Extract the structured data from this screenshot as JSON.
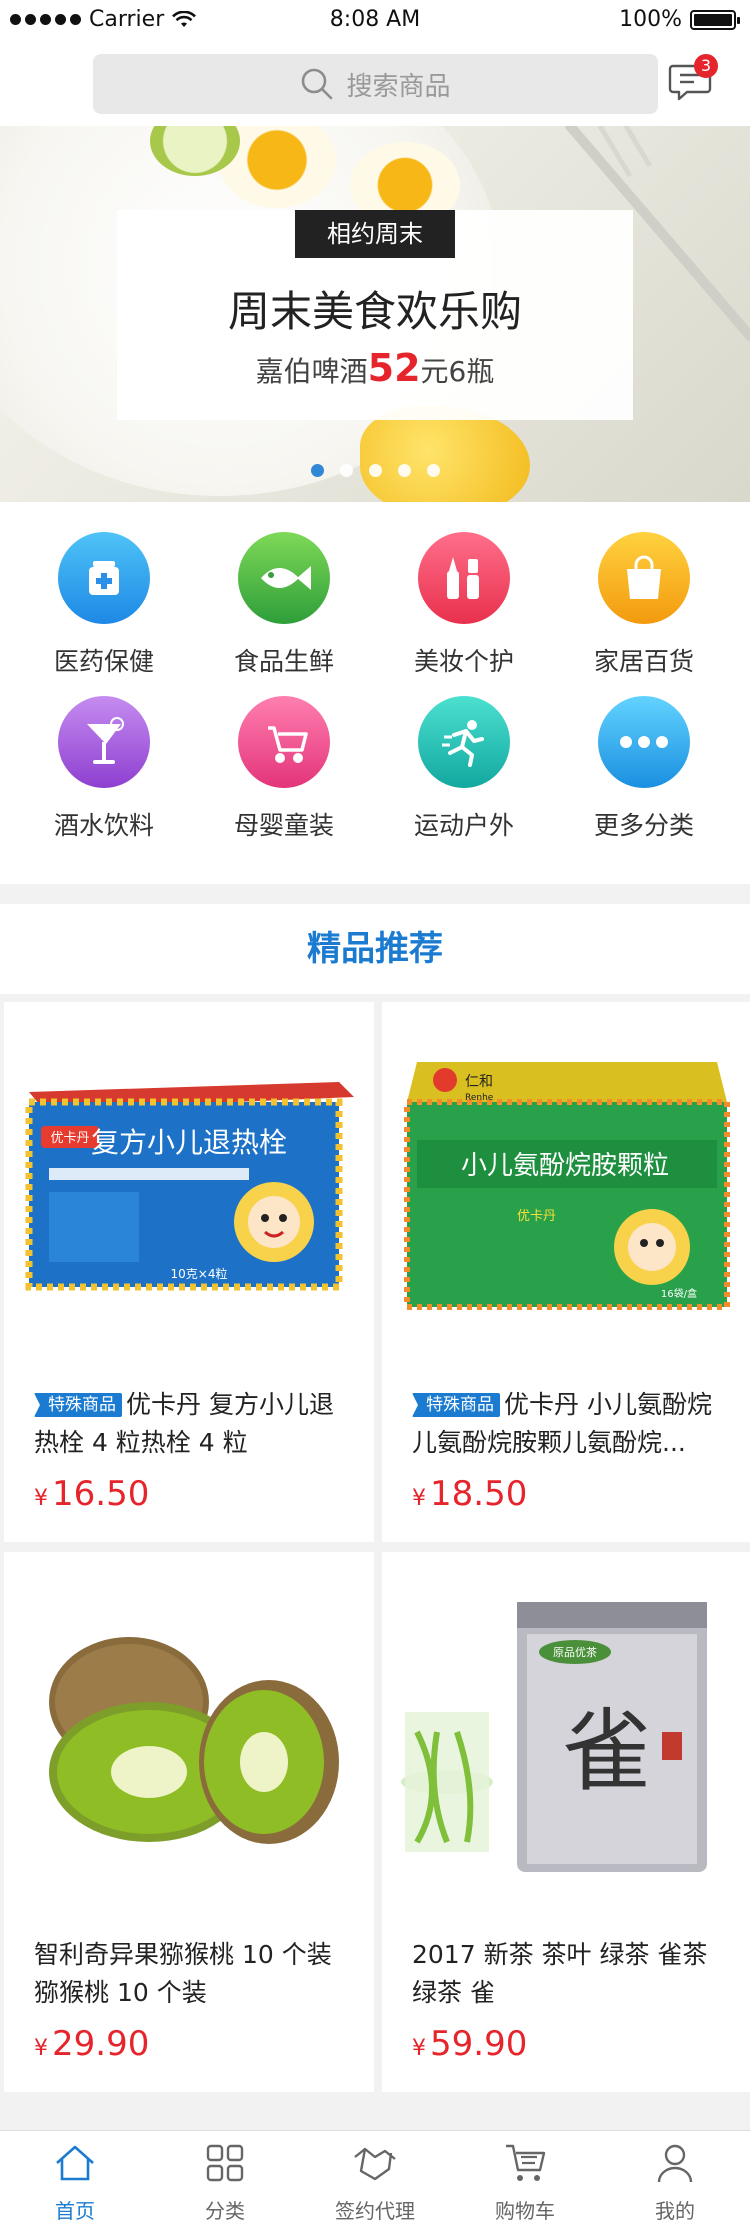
{
  "status_bar": {
    "carrier": "Carrier",
    "time": "8:08 AM",
    "battery": "100%"
  },
  "header": {
    "search_placeholder": "搜索商品",
    "message_badge": "3"
  },
  "banner": {
    "tag": "相约周末",
    "title": "周末美食欢乐购",
    "sub_before": "嘉伯啤酒",
    "sub_price": "52",
    "sub_after": "元6瓶",
    "page_count": 5,
    "active_page": 1
  },
  "categories": [
    {
      "label": "医药保健",
      "icon": "medicine-icon",
      "color_from": "#4fc3f7",
      "color_to": "#1e88e5"
    },
    {
      "label": "食品生鲜",
      "icon": "fish-icon",
      "color_from": "#7ed957",
      "color_to": "#2e9e3a"
    },
    {
      "label": "美妆个护",
      "icon": "makeup-icon",
      "color_from": "#ff6f8a",
      "color_to": "#e8304d"
    },
    {
      "label": "家居百货",
      "icon": "shopping-bag-icon",
      "color_from": "#ffd23f",
      "color_to": "#f39a0e"
    },
    {
      "label": "酒水饮料",
      "icon": "drink-icon",
      "color_from": "#c58cf0",
      "color_to": "#8e3fd0"
    },
    {
      "label": "母婴童装",
      "icon": "stroller-icon",
      "color_from": "#ff7fb0",
      "color_to": "#e3347a"
    },
    {
      "label": "运动户外",
      "icon": "running-icon",
      "color_from": "#4be0d0",
      "color_to": "#13a8a0"
    },
    {
      "label": "更多分类",
      "icon": "more-icon",
      "color_from": "#62d3ff",
      "color_to": "#1a8fe0"
    }
  ],
  "section_title": "精品推荐",
  "products": [
    {
      "tag": "特殊商品",
      "name": "优卡丹 复方小儿退热栓 4 粒热栓 4 粒",
      "currency": "¥",
      "price": "16.50",
      "box_title": "复方小儿退热栓",
      "brand": "优卡丹",
      "box_note": "10克×4粒"
    },
    {
      "tag": "特殊商品",
      "name": "优卡丹 小儿氨酚烷儿氨酚烷胺颗儿氨酚烷...",
      "currency": "¥",
      "price": "18.50",
      "box_title": "小儿氨酚烷胺颗粒",
      "brand": "优卡丹",
      "maker": "仁和",
      "maker_en": "Renhe",
      "box_note": "16袋/盒"
    },
    {
      "tag": "",
      "name": "智利奇异果猕猴桃 10 个装 猕猴桃 10 个装",
      "currency": "¥",
      "price": "29.90"
    },
    {
      "tag": "",
      "name": "2017 新茶 茶叶 绿茶 雀茶 绿茶 雀",
      "currency": "¥",
      "price": "59.90",
      "can_brand": "原品优茶",
      "can_char": "雀"
    }
  ],
  "tabbar": [
    {
      "label": "首页",
      "icon": "home-icon",
      "active": true
    },
    {
      "label": "分类",
      "icon": "category-grid-icon",
      "active": false
    },
    {
      "label": "签约代理",
      "icon": "handshake-icon",
      "active": false
    },
    {
      "label": "购物车",
      "icon": "cart-icon",
      "active": false
    },
    {
      "label": "我的",
      "icon": "user-icon",
      "active": false
    }
  ]
}
